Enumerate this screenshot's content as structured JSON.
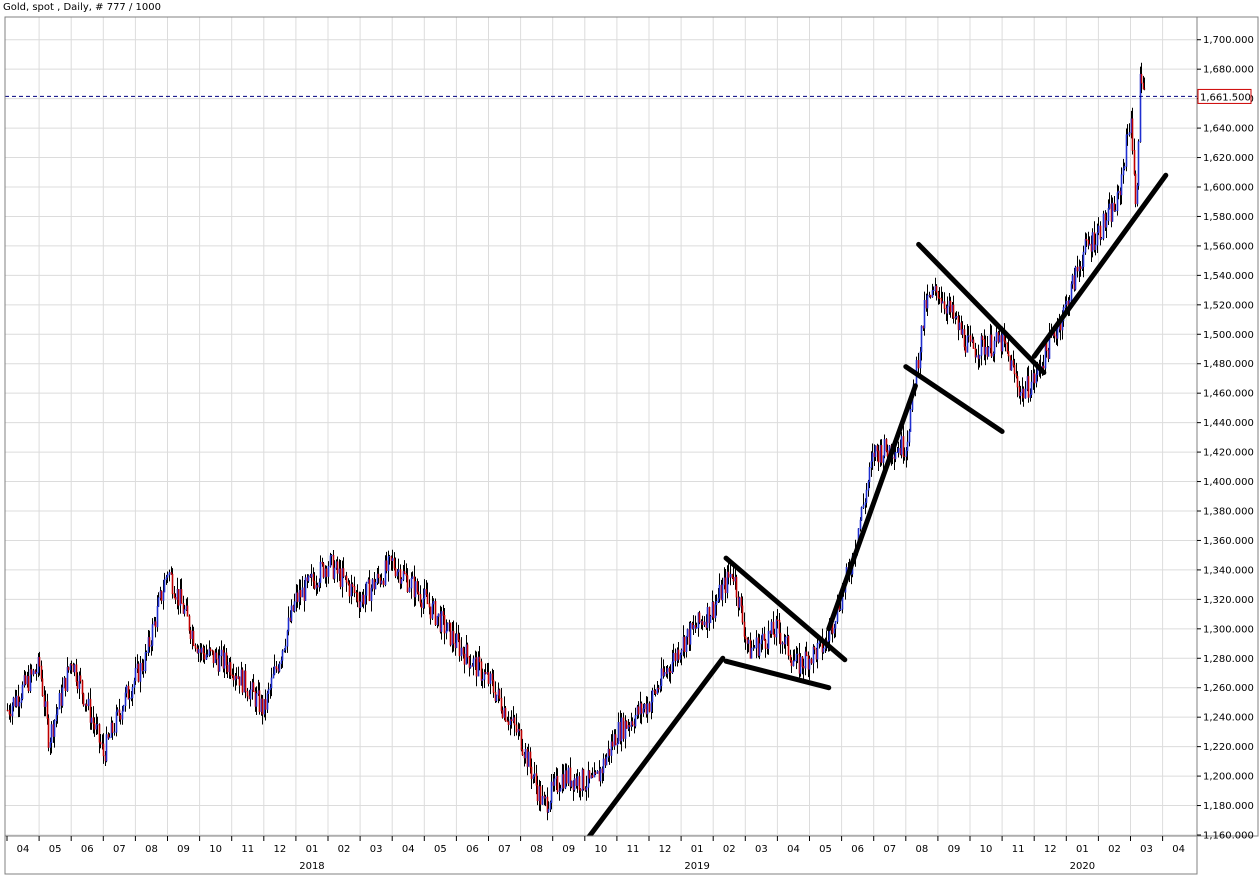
{
  "header": {
    "title": "Gold, spot , Daily, # 777 / 1000"
  },
  "current_price": {
    "label": "1,661.500",
    "value": 1661.5,
    "color": "#cc0000"
  },
  "colors": {
    "up_bar": "#1f2fd0",
    "down_bar": "#c00000",
    "grid": "#dcdcdc",
    "annotation": "#000000"
  },
  "chart_data": {
    "type": "candlestick",
    "instrument": "Gold, spot",
    "interval": "Daily",
    "ylim": [
      1160,
      1710
    ],
    "y_ticks": [
      "1,160.000",
      "1,180.000",
      "1,200.000",
      "1,220.000",
      "1,240.000",
      "1,260.000",
      "1,280.000",
      "1,300.000",
      "1,320.000",
      "1,340.000",
      "1,360.000",
      "1,380.000",
      "1,400.000",
      "1,420.000",
      "1,440.000",
      "1,460.000",
      "1,480.000",
      "1,500.000",
      "1,520.000",
      "1,540.000",
      "1,560.000",
      "1,580.000",
      "1,600.000",
      "1,620.000",
      "1,640.000",
      "1,660.000",
      "1,680.000",
      "1,700.000"
    ],
    "month_labels": [
      "04",
      "05",
      "06",
      "07",
      "08",
      "09",
      "10",
      "11",
      "12",
      "01",
      "02",
      "03",
      "04",
      "05",
      "06",
      "07",
      "08",
      "09",
      "10",
      "11",
      "12",
      "01",
      "02",
      "03",
      "04",
      "05",
      "06",
      "07",
      "08",
      "09",
      "10",
      "11",
      "12",
      "01",
      "02",
      "03",
      "04"
    ],
    "year_labels": [
      {
        "label": "2018",
        "month_index": 9
      },
      {
        "label": "2019",
        "month_index": 21
      },
      {
        "label": "2020",
        "month_index": 33
      }
    ],
    "price_path_anchors": [
      {
        "month": 0,
        "price": 1245
      },
      {
        "month": 1,
        "price": 1275
      },
      {
        "month": 1.3,
        "price": 1225
      },
      {
        "month": 2,
        "price": 1280
      },
      {
        "month": 3,
        "price": 1215
      },
      {
        "month": 3.6,
        "price": 1250
      },
      {
        "month": 4.3,
        "price": 1280
      },
      {
        "month": 5,
        "price": 1340
      },
      {
        "month": 6,
        "price": 1285
      },
      {
        "month": 7,
        "price": 1275
      },
      {
        "month": 8,
        "price": 1245
      },
      {
        "month": 9,
        "price": 1320
      },
      {
        "month": 10,
        "price": 1345
      },
      {
        "month": 11,
        "price": 1320
      },
      {
        "month": 12,
        "price": 1345
      },
      {
        "month": 13,
        "price": 1320
      },
      {
        "month": 14,
        "price": 1290
      },
      {
        "month": 15,
        "price": 1265
      },
      {
        "month": 16,
        "price": 1225
      },
      {
        "month": 16.7,
        "price": 1180
      },
      {
        "month": 17.3,
        "price": 1200
      },
      {
        "month": 18.3,
        "price": 1195
      },
      {
        "month": 19,
        "price": 1230
      },
      {
        "month": 20,
        "price": 1250
      },
      {
        "month": 21,
        "price": 1290
      },
      {
        "month": 22,
        "price": 1315
      },
      {
        "month": 22.6,
        "price": 1340
      },
      {
        "month": 23.1,
        "price": 1285
      },
      {
        "month": 24,
        "price": 1300
      },
      {
        "month": 24.6,
        "price": 1275
      },
      {
        "month": 25.5,
        "price": 1290
      },
      {
        "month": 26.3,
        "price": 1345
      },
      {
        "month": 27,
        "price": 1420
      },
      {
        "month": 28,
        "price": 1425
      },
      {
        "month": 28.6,
        "price": 1520
      },
      {
        "month": 29,
        "price": 1530
      },
      {
        "month": 30,
        "price": 1490
      },
      {
        "month": 31,
        "price": 1495
      },
      {
        "month": 31.6,
        "price": 1460
      },
      {
        "month": 32,
        "price": 1470
      },
      {
        "month": 33,
        "price": 1520
      },
      {
        "month": 33.5,
        "price": 1555
      },
      {
        "month": 34,
        "price": 1570
      },
      {
        "month": 34.6,
        "price": 1590
      },
      {
        "month": 35,
        "price": 1650
      },
      {
        "month": 35.15,
        "price": 1580
      },
      {
        "month": 35.3,
        "price": 1680
      },
      {
        "month": 35.45,
        "price": 1661.5
      }
    ],
    "trendlines": [
      {
        "from": {
          "month": 18.0,
          "price": 1155
        },
        "to": {
          "month": 22.3,
          "price": 1280
        }
      },
      {
        "from": {
          "month": 22.4,
          "price": 1348
        },
        "to": {
          "month": 26.1,
          "price": 1279
        }
      },
      {
        "from": {
          "month": 22.4,
          "price": 1278
        },
        "to": {
          "month": 25.6,
          "price": 1260
        }
      },
      {
        "from": {
          "month": 25.6,
          "price": 1300
        },
        "to": {
          "month": 28.3,
          "price": 1465
        }
      },
      {
        "from": {
          "month": 28.4,
          "price": 1561
        },
        "to": {
          "month": 32.3,
          "price": 1474
        }
      },
      {
        "from": {
          "month": 28.0,
          "price": 1478
        },
        "to": {
          "month": 31.0,
          "price": 1434
        }
      },
      {
        "from": {
          "month": 32.0,
          "price": 1485
        },
        "to": {
          "month": 36.1,
          "price": 1608
        }
      }
    ]
  }
}
